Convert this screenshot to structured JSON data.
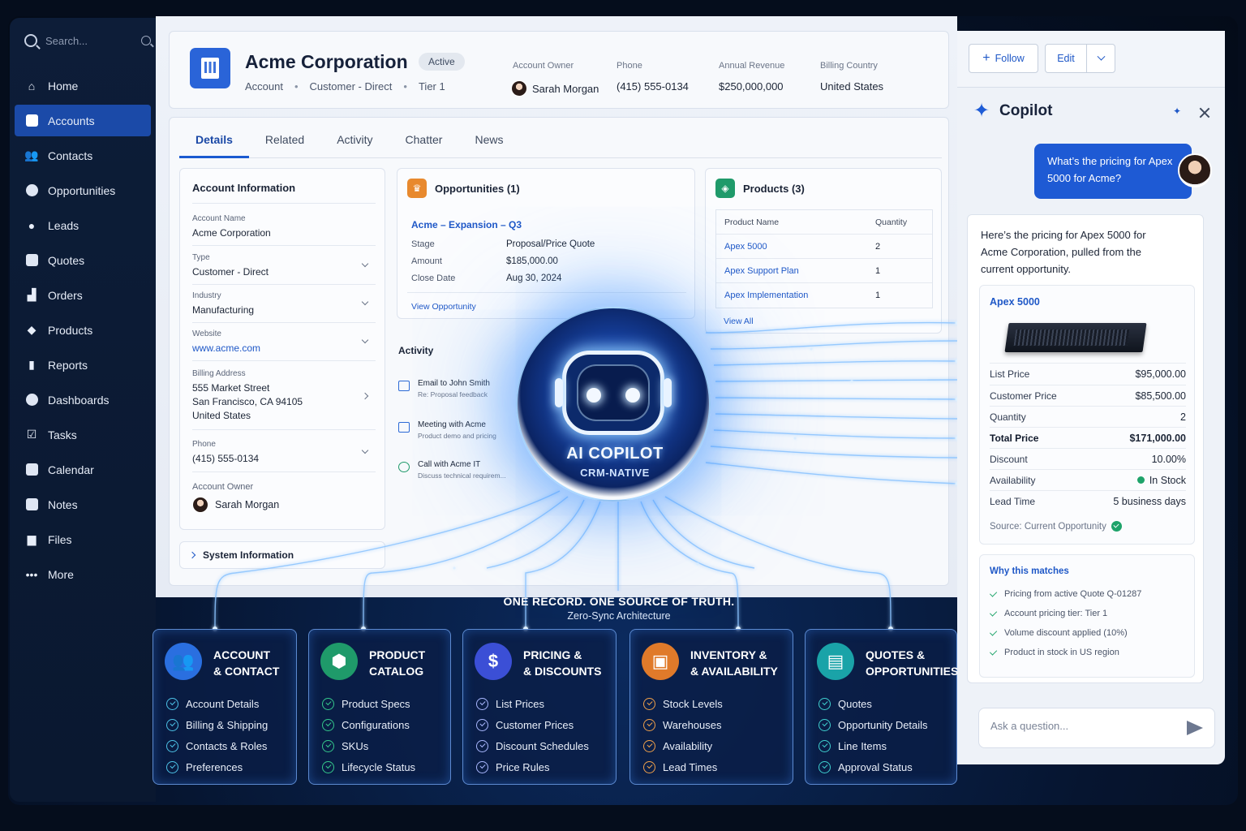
{
  "sidebar": {
    "search_placeholder": "Search...",
    "items": [
      {
        "label": "Home",
        "icon": "home-icon"
      },
      {
        "label": "Accounts",
        "icon": "accounts-icon",
        "active": true
      },
      {
        "label": "Contacts",
        "icon": "contacts-icon"
      },
      {
        "label": "Opportunities",
        "icon": "opportunities-icon"
      },
      {
        "label": "Leads",
        "icon": "leads-icon"
      },
      {
        "label": "Quotes",
        "icon": "quotes-icon"
      },
      {
        "label": "Orders",
        "icon": "cart-icon"
      },
      {
        "label": "Products",
        "icon": "box-icon"
      },
      {
        "label": "Reports",
        "icon": "bar-chart-icon"
      },
      {
        "label": "Dashboards",
        "icon": "pie-chart-icon"
      },
      {
        "label": "Tasks",
        "icon": "checkbox-icon"
      },
      {
        "label": "Calendar",
        "icon": "calendar-icon"
      },
      {
        "label": "Notes",
        "icon": "notes-icon"
      },
      {
        "label": "Files",
        "icon": "folder-icon"
      },
      {
        "label": "More",
        "icon": "more-icon"
      }
    ]
  },
  "header": {
    "name": "Acme Corporation",
    "status": "Active",
    "type": "Account",
    "segment": "Customer - Direct",
    "tier": "Tier 1",
    "owner_label": "Account Owner",
    "owner": "Sarah Morgan",
    "phone_label": "Phone",
    "phone": "(415) 555-0134",
    "revenue_label": "Annual Revenue",
    "revenue": "$250,000,000",
    "country_label": "Billing Country",
    "country": "United States"
  },
  "tabs": [
    "Details",
    "Related",
    "Activity",
    "Chatter",
    "News"
  ],
  "account_info": {
    "title": "Account Information",
    "fields": [
      {
        "label": "Account Name",
        "value": "Acme Corporation"
      },
      {
        "label": "Type",
        "value": "Customer - Direct"
      },
      {
        "label": "Industry",
        "value": "Manufacturing"
      },
      {
        "label": "Website",
        "value": "www.acme.com"
      },
      {
        "label": "Billing Address",
        "value_lines": [
          "555 Market Street",
          "San Francisco, CA 94105",
          "United States"
        ]
      },
      {
        "label": "Phone",
        "value": "(415) 555-0134"
      },
      {
        "label": "Account Owner",
        "value": "Sarah Morgan"
      }
    ],
    "system_info": "System Information"
  },
  "opportunities": {
    "title": "Opportunities (1)",
    "name": "Acme – Expansion – Q3",
    "rows": [
      {
        "label": "Stage",
        "value": "Proposal/Price Quote"
      },
      {
        "label": "Amount",
        "value": "$185,000.00"
      },
      {
        "label": "Close Date",
        "value": "Aug 30, 2024"
      }
    ],
    "view_link": "View Opportunity"
  },
  "products": {
    "title": "Products (3)",
    "columns": [
      "Product Name",
      "Quantity"
    ],
    "rows": [
      {
        "name": "Apex 5000",
        "qty": "2"
      },
      {
        "name": "Apex Support Plan",
        "qty": "1"
      },
      {
        "name": "Apex Implementation",
        "qty": "1"
      }
    ],
    "view_all": "View All"
  },
  "activity": {
    "title": "Activity",
    "items": [
      {
        "title": "Email to John Smith",
        "sub": "Re: Proposal feedback"
      },
      {
        "title": "Meeting with Acme",
        "sub": "Product demo and pricing"
      },
      {
        "title": "Call with Acme IT",
        "sub": "Discuss technical requirem..."
      }
    ]
  },
  "copilot_core": {
    "title": "AI COPILOT",
    "subtitle": "CRM-NATIVE",
    "tagline": "ONE RECORD. ONE SOURCE OF TRUTH.",
    "tagline_sub": "Zero-Sync Architecture"
  },
  "feature_cards": [
    {
      "title_lines": [
        "ACCOUNT",
        "& CONTACT"
      ],
      "icon": "users-icon",
      "color": "#2a6fe0",
      "check_color": "#4dc3e8",
      "items": [
        "Account Details",
        "Billing & Shipping",
        "Contacts & Roles",
        "Preferences"
      ]
    },
    {
      "title_lines": [
        "PRODUCT",
        "CATALOG"
      ],
      "icon": "cube-icon",
      "color": "#1f9a6a",
      "check_color": "#35c98c",
      "items": [
        "Product Specs",
        "Configurations",
        "SKUs",
        "Lifecycle Status"
      ]
    },
    {
      "title_lines": [
        "PRICING &",
        "& DISCOUNTS"
      ],
      "icon": "dollar-icon",
      "color": "#3b4fd6",
      "check_color": "#a9b8ff",
      "items": [
        "List Prices",
        "Customer Prices",
        "Discount Schedules",
        "Price Rules"
      ]
    },
    {
      "title_lines": [
        "INVENTORY &",
        "& AVAILABILITY"
      ],
      "icon": "boxes-icon",
      "color": "#e07a2a",
      "check_color": "#f0a04a",
      "items": [
        "Stock Levels",
        "Warehouses",
        "Availability",
        "Lead Times"
      ]
    },
    {
      "title_lines": [
        "QUOTES &",
        "OPPORTUNITIES"
      ],
      "icon": "document-icon",
      "color": "#1aa3a8",
      "check_color": "#3fd0d0",
      "items": [
        "Quotes",
        "Opportunity Details",
        "Line Items",
        "Approval Status"
      ]
    }
  ],
  "right_panel": {
    "follow": "Follow",
    "edit": "Edit",
    "title": "Copilot",
    "user_message": "What’s the pricing for Apex 5000 for Acme?",
    "response": "Here’s the pricing for Apex 5000 for Acme Corporation, pulled from the current opportunity.",
    "product_title": "Apex 5000",
    "price_rows": [
      {
        "label": "List Price",
        "value": "$95,000.00"
      },
      {
        "label": "Customer Price",
        "value": "$85,500.00"
      },
      {
        "label": "Quantity",
        "value": "2"
      },
      {
        "label": "Total Price",
        "value": "$171,000.00",
        "bold": true
      },
      {
        "label": "Discount",
        "value": "10.00%"
      },
      {
        "label": "Availability",
        "value": "In Stock"
      },
      {
        "label": "Lead Time",
        "value": "5 business days"
      }
    ],
    "source": "Source: Current Opportunity",
    "why_title": "Why this matches",
    "why_items": [
      "Pricing from active Quote Q-01287",
      "Account pricing tier: Tier 1",
      "Volume discount applied (10%)",
      "Product in stock in US region"
    ],
    "ask_placeholder": "Ask a question..."
  }
}
